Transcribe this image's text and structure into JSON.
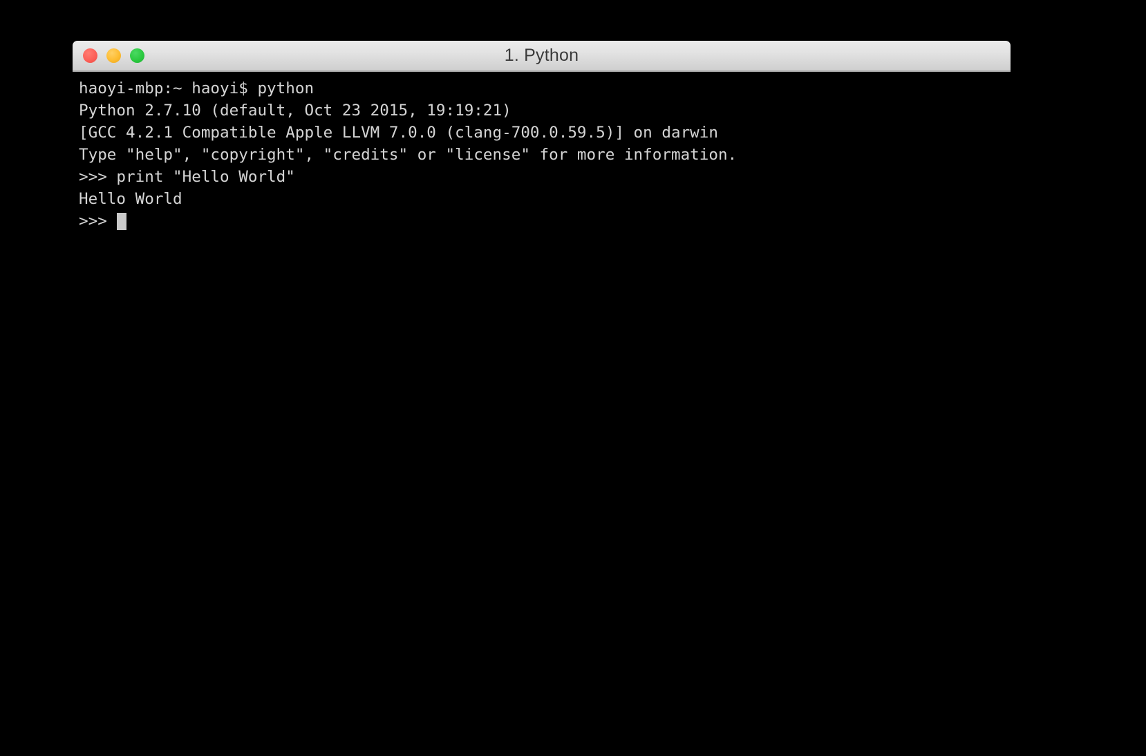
{
  "window": {
    "title": "1. Python",
    "controls": [
      {
        "name": "close",
        "color": "#fc6058"
      },
      {
        "name": "minimize",
        "color": "#fdbc31"
      },
      {
        "name": "zoom",
        "color": "#2bc940"
      }
    ]
  },
  "terminal": {
    "background_color": "#000000",
    "text_color": "#d4d4d4",
    "cursor_color": "#c9c9c9",
    "lines": [
      "haoyi-mbp:~ haoyi$ python",
      "Python 2.7.10 (default, Oct 23 2015, 19:19:21)",
      "[GCC 4.2.1 Compatible Apple LLVM 7.0.0 (clang-700.0.59.5)] on darwin",
      "Type \"help\", \"copyright\", \"credits\" or \"license\" for more information.",
      ">>> print \"Hello World\"",
      "Hello World"
    ],
    "prompt": ">>> "
  }
}
